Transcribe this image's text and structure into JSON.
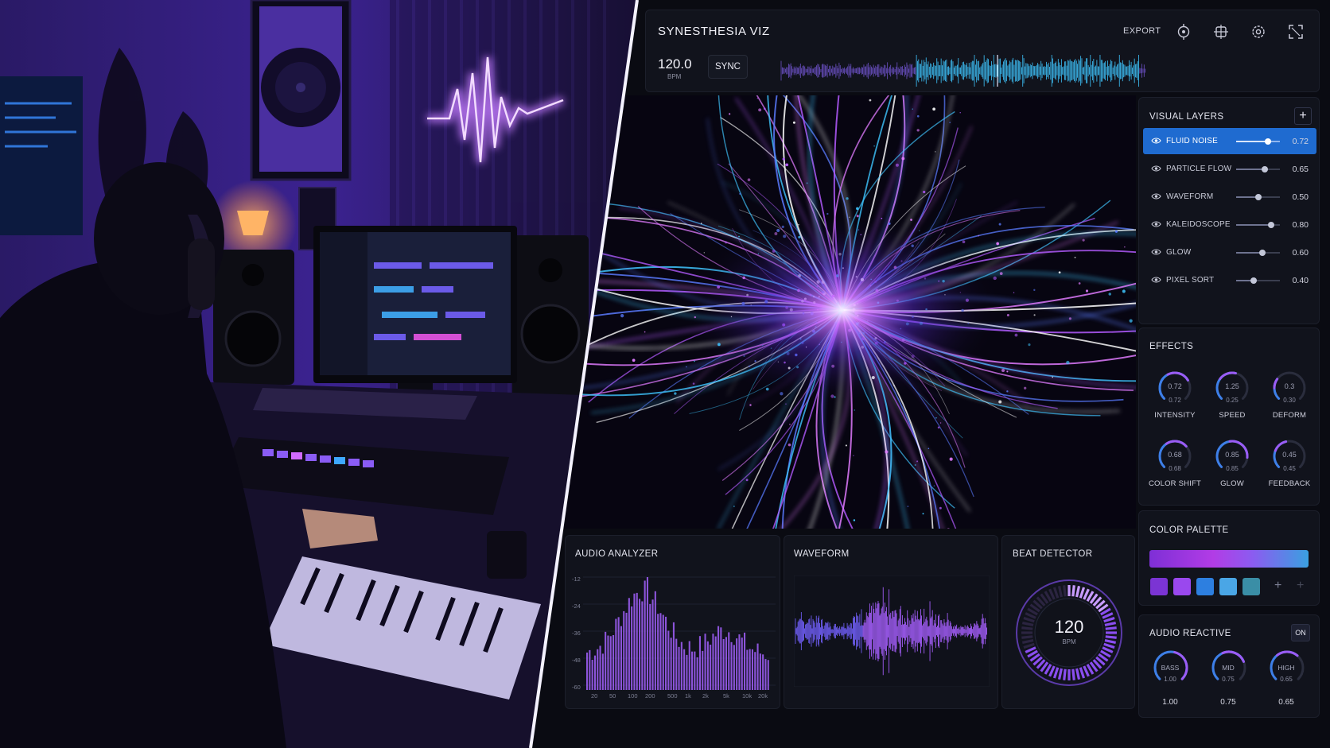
{
  "app": {
    "title": "SYNESTHESIA VIZ",
    "export_label": "EXPORT",
    "icons": [
      "settings-icon",
      "crop-icon",
      "gear-icon",
      "fullscreen-icon"
    ],
    "bpm_value": "120.0",
    "bpm_unit": "BPM",
    "sync_label": "SYNC"
  },
  "visual_layers": {
    "title": "VISUAL LAYERS",
    "add_label": "+",
    "items": [
      {
        "name": "FLUID NOISE",
        "value": "0.72",
        "level": 0.72,
        "active": true
      },
      {
        "name": "PARTICLE FLOW",
        "value": "0.65",
        "level": 0.65,
        "active": false
      },
      {
        "name": "WAVEFORM",
        "value": "0.50",
        "level": 0.5,
        "active": false
      },
      {
        "name": "KALEIDOSCOPE",
        "value": "0.80",
        "level": 0.8,
        "active": false
      },
      {
        "name": "GLOW",
        "value": "0.60",
        "level": 0.6,
        "active": false
      },
      {
        "name": "PIXEL SORT",
        "value": "0.40",
        "level": 0.4,
        "active": false
      }
    ]
  },
  "effects": {
    "title": "EFFECTS",
    "knobs": [
      {
        "label": "INTENSITY",
        "value": "0.72",
        "sub": "0.72",
        "level": 0.72
      },
      {
        "label": "SPEED",
        "value": "1.25",
        "sub": "0.25",
        "level": 0.55
      },
      {
        "label": "DEFORM",
        "value": "0.3",
        "sub": "0.30",
        "level": 0.3
      },
      {
        "label": "COLOR SHIFT",
        "value": "0.68",
        "sub": "0.68",
        "level": 0.68
      },
      {
        "label": "GLOW",
        "value": "0.85",
        "sub": "0.85",
        "level": 0.85
      },
      {
        "label": "FEEDBACK",
        "value": "0.45",
        "sub": "0.45",
        "level": 0.45
      }
    ]
  },
  "color_palette": {
    "title": "COLOR PALETTE",
    "swatches": [
      "#7b34d4",
      "#9a48ee",
      "#2d7fe0",
      "#4aa6e6",
      "#3a8ea6"
    ],
    "add_label": "+"
  },
  "audio_reactive": {
    "title": "AUDIO REACTIVE",
    "toggle_label": "ON",
    "bands": [
      {
        "name": "BASS",
        "value": "1.00",
        "display": "1.00",
        "level": 1.0
      },
      {
        "name": "MID",
        "value": "0.75",
        "display": "0.75",
        "level": 0.75
      },
      {
        "name": "HIGH",
        "value": "0.65",
        "display": "0.65",
        "level": 0.65
      }
    ]
  },
  "audio_analyzer": {
    "title": "AUDIO ANALYZER",
    "y_ticks": [
      "-12",
      "-24",
      "-36",
      "-48",
      "-60"
    ],
    "x_ticks": [
      "20",
      "50",
      "100",
      "200",
      "500",
      "1k",
      "2k",
      "5k",
      "10k",
      "20k"
    ]
  },
  "waveform": {
    "title": "WAVEFORM"
  },
  "beat_detector": {
    "title": "BEAT DETECTOR",
    "bpm": "120",
    "unit": "BPM"
  },
  "colors": {
    "accent": "#1f6bd0",
    "purple": "#9b5cf5",
    "cyan": "#3fc6ff",
    "panel": "#11131c"
  }
}
